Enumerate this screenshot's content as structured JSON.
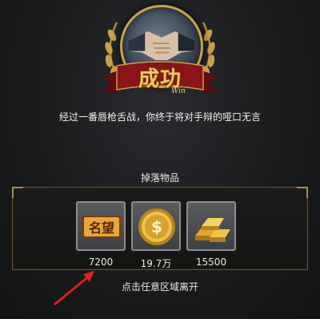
{
  "result": {
    "title": "成功",
    "subtitle_en": "Win",
    "message": "经过一番唇枪舌战，你终于将对手辩的哑口无言"
  },
  "drops": {
    "title": "掉落物品",
    "items": [
      {
        "icon": "prestige-icon",
        "badge_text": "名望",
        "amount": "7200"
      },
      {
        "icon": "gold-coin-icon",
        "amount": "19.7万"
      },
      {
        "icon": "gold-bars-icon",
        "amount": "15500"
      }
    ]
  },
  "footer": {
    "hint": "点击任意区域离开"
  },
  "colors": {
    "accent_gold": "#f2c766",
    "ribbon_red": "#8a1416",
    "arrow_red": "#e0201c"
  }
}
